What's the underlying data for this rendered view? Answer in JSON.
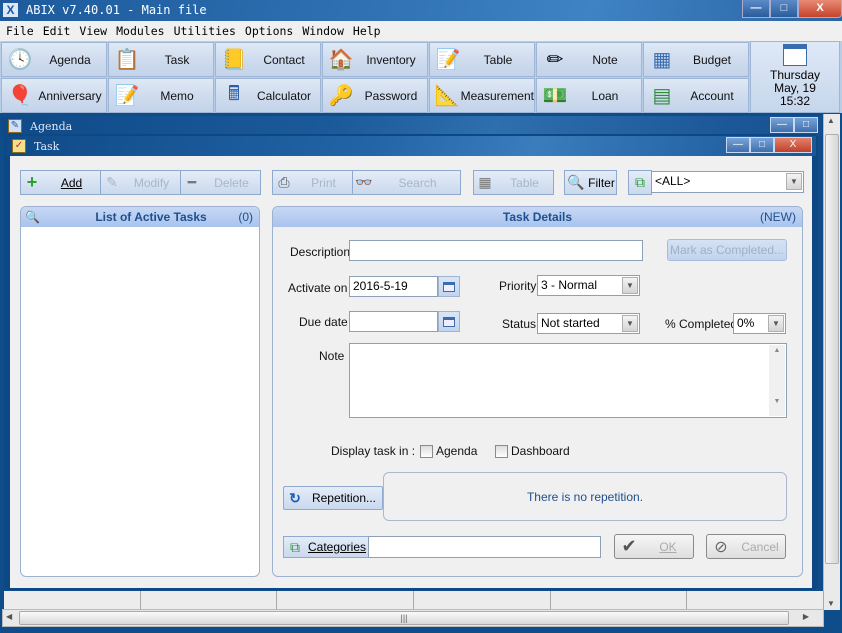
{
  "window": {
    "title": "ABIX v7.40.01  -  Main file",
    "controls": {
      "minimize": "—",
      "maximize": "□",
      "close": "X"
    }
  },
  "menu": [
    {
      "label": "File",
      "accel": "F"
    },
    {
      "label": "Edit",
      "accel": "E"
    },
    {
      "label": "View",
      "accel": "V"
    },
    {
      "label": "Modules",
      "accel": "M"
    },
    {
      "label": "Utilities",
      "accel": "U"
    },
    {
      "label": "Options",
      "accel": "O"
    },
    {
      "label": "Window",
      "accel": "W"
    },
    {
      "label": "Help",
      "accel": "H"
    }
  ],
  "modules": [
    {
      "label": "Agenda",
      "icon": "agenda-clock-icon",
      "glyph": "🕓"
    },
    {
      "label": "Task",
      "icon": "clipboard-check-icon",
      "glyph": "📋"
    },
    {
      "label": "Contact",
      "icon": "address-book-icon",
      "glyph": "📒"
    },
    {
      "label": "Inventory",
      "icon": "house-icon",
      "glyph": "🏠"
    },
    {
      "label": "Table",
      "icon": "table-pencil-icon",
      "glyph": "📝"
    },
    {
      "label": "Note",
      "icon": "note-pencil-icon",
      "glyph": "✏"
    },
    {
      "label": "Budget",
      "icon": "budget-sheet-icon",
      "glyph": "▦"
    },
    {
      "label": "Anniversary",
      "icon": "anniversary-balls-icon",
      "glyph": "🎈"
    },
    {
      "label": "Memo",
      "icon": "memo-pencil-icon",
      "glyph": "📝"
    },
    {
      "label": "Calculator",
      "icon": "calculator-icon",
      "glyph": "🖩"
    },
    {
      "label": "Password",
      "icon": "password-key-icon",
      "glyph": "🔑"
    },
    {
      "label": "Measurement",
      "icon": "ruler-pencil-icon",
      "glyph": "📐"
    },
    {
      "label": "Loan",
      "icon": "money-coins-icon",
      "glyph": "💵"
    },
    {
      "label": "Account",
      "icon": "account-ledger-icon",
      "glyph": "▤"
    }
  ],
  "date": {
    "weekday": "Thursday",
    "day": "May, 19",
    "time": "15:32"
  },
  "agenda_window": {
    "title": "Agenda"
  },
  "task_window": {
    "title": "Task"
  },
  "toolbar": {
    "add": "Add",
    "modify": "Modify",
    "delete": "Delete",
    "print": "Print",
    "search": "Search",
    "table": "Table",
    "filter": "Filter",
    "category_filter": "<ALL>"
  },
  "task_list": {
    "title": "List of Active Tasks",
    "count": "(0)",
    "items": []
  },
  "task_details": {
    "title": "Task Details",
    "state": "(NEW)",
    "description_label": "Description",
    "description_value": "",
    "mark_completed": "Mark as Completed...",
    "activate_label": "Activate on",
    "activate_value": "2016-5-19",
    "priority_label": "Priority",
    "priority_value": "3 - Normal",
    "due_label": "Due date",
    "due_value": "",
    "status_label": "Status",
    "status_value": "Not started",
    "percent_label": "% Completed",
    "percent_value": "0%",
    "note_label": "Note",
    "note_value": "",
    "display_in_label": "Display task in :",
    "display_agenda": "Agenda",
    "display_agenda_checked": false,
    "display_dashboard": "Dashboard",
    "display_dashboard_checked": false,
    "repetition_button": "Repetition...",
    "repetition_text": "There is no repetition.",
    "categories_button": "Categories",
    "categories_value": "",
    "ok": "OK",
    "cancel": "Cancel"
  }
}
